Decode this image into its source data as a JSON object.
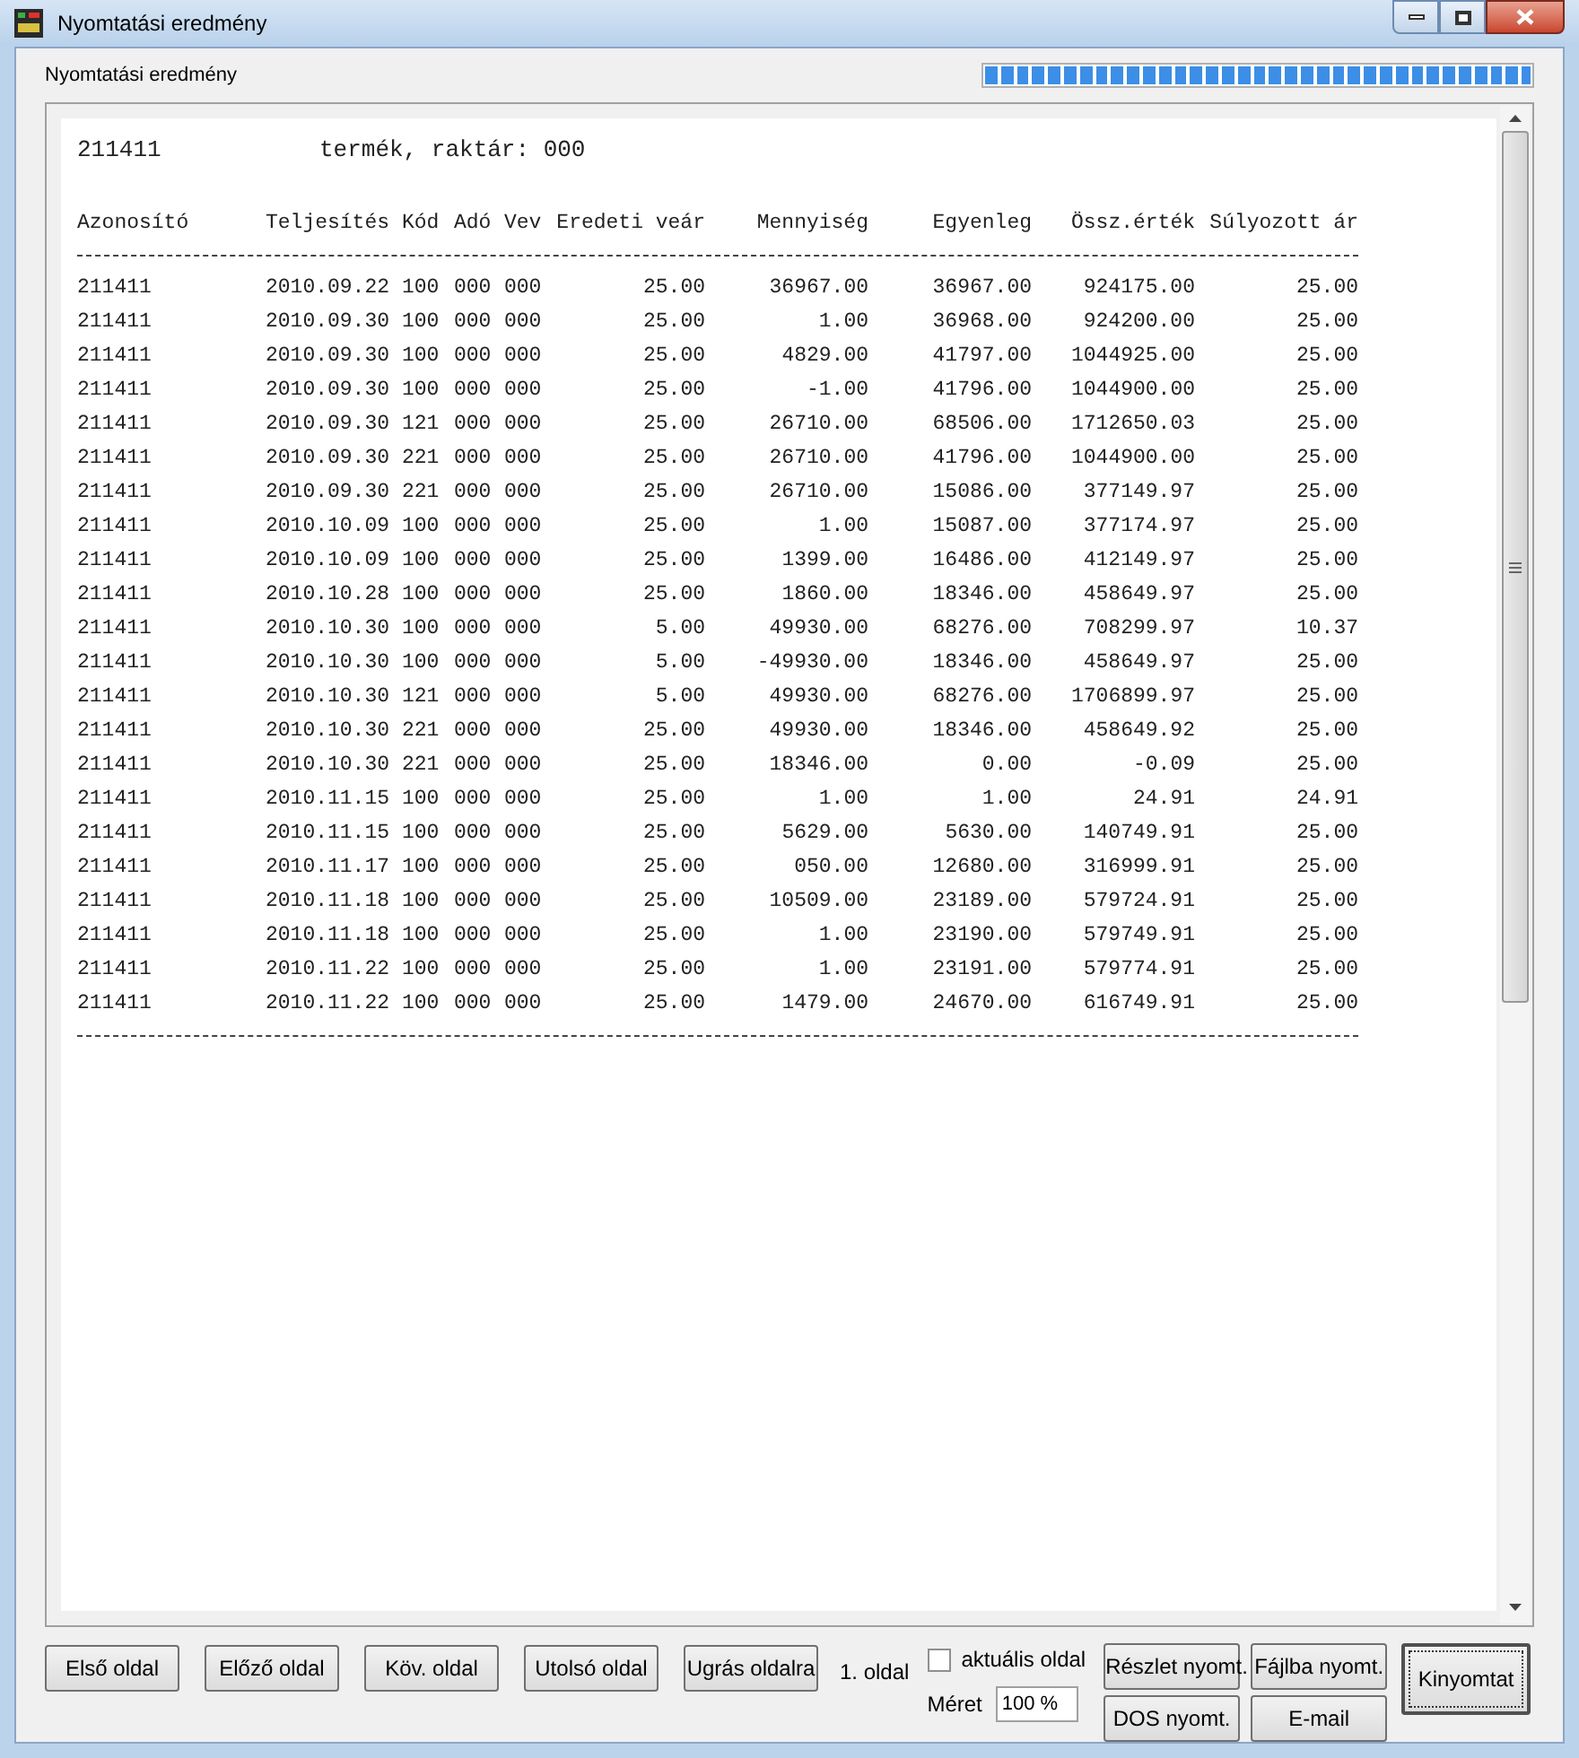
{
  "window": {
    "title": "Nyomtatási eredmény"
  },
  "header": {
    "label": "Nyomtatási eredmény",
    "progress": {
      "level": 1
    }
  },
  "report": {
    "heading": [
      "211411",
      "termék, raktár: 000"
    ],
    "columns": [
      {
        "label": "Azonosító",
        "kind": "text"
      },
      {
        "label": "Teljesítés",
        "kind": "text"
      },
      {
        "label": "Kód",
        "kind": "text"
      },
      {
        "label": "Adó",
        "kind": "text"
      },
      {
        "label": "Vev",
        "kind": "text"
      },
      {
        "label": "Eredeti veár",
        "kind": "number"
      },
      {
        "label": "Mennyiség",
        "kind": "number"
      },
      {
        "label": "Egyenleg",
        "kind": "number"
      },
      {
        "label": "Össz.érték",
        "kind": "number"
      },
      {
        "label": "Súlyozott ár",
        "kind": "number"
      }
    ],
    "rows": [
      [
        "211411",
        "2010.09.22",
        "100",
        "000",
        "000",
        "25.00",
        "36967.00",
        "36967.00",
        "924175.00",
        "25.00"
      ],
      [
        "211411",
        "2010.09.30",
        "100",
        "000",
        "000",
        "25.00",
        "1.00",
        "36968.00",
        "924200.00",
        "25.00"
      ],
      [
        "211411",
        "2010.09.30",
        "100",
        "000",
        "000",
        "25.00",
        "4829.00",
        "41797.00",
        "1044925.00",
        "25.00"
      ],
      [
        "211411",
        "2010.09.30",
        "100",
        "000",
        "000",
        "25.00",
        "-1.00",
        "41796.00",
        "1044900.00",
        "25.00"
      ],
      [
        "211411",
        "2010.09.30",
        "121",
        "000",
        "000",
        "25.00",
        "26710.00",
        "68506.00",
        "1712650.03",
        "25.00"
      ],
      [
        "211411",
        "2010.09.30",
        "221",
        "000",
        "000",
        "25.00",
        "26710.00",
        "41796.00",
        "1044900.00",
        "25.00"
      ],
      [
        "211411",
        "2010.09.30",
        "221",
        "000",
        "000",
        "25.00",
        "26710.00",
        "15086.00",
        "377149.97",
        "25.00"
      ],
      [
        "211411",
        "2010.10.09",
        "100",
        "000",
        "000",
        "25.00",
        "1.00",
        "15087.00",
        "377174.97",
        "25.00"
      ],
      [
        "211411",
        "2010.10.09",
        "100",
        "000",
        "000",
        "25.00",
        "1399.00",
        "16486.00",
        "412149.97",
        "25.00"
      ],
      [
        "211411",
        "2010.10.28",
        "100",
        "000",
        "000",
        "25.00",
        "1860.00",
        "18346.00",
        "458649.97",
        "25.00"
      ],
      [
        "211411",
        "2010.10.30",
        "100",
        "000",
        "000",
        "5.00",
        "49930.00",
        "68276.00",
        "708299.97",
        "10.37"
      ],
      [
        "211411",
        "2010.10.30",
        "100",
        "000",
        "000",
        "5.00",
        "-49930.00",
        "18346.00",
        "458649.97",
        "25.00"
      ],
      [
        "211411",
        "2010.10.30",
        "121",
        "000",
        "000",
        "5.00",
        "49930.00",
        "68276.00",
        "1706899.97",
        "25.00"
      ],
      [
        "211411",
        "2010.10.30",
        "221",
        "000",
        "000",
        "25.00",
        "49930.00",
        "18346.00",
        "458649.92",
        "25.00"
      ],
      [
        "211411",
        "2010.10.30",
        "221",
        "000",
        "000",
        "25.00",
        "18346.00",
        "0.00",
        "-0.09",
        "25.00"
      ],
      [
        "211411",
        "2010.11.15",
        "100",
        "000",
        "000",
        "25.00",
        "1.00",
        "1.00",
        "24.91",
        "24.91"
      ],
      [
        "211411",
        "2010.11.15",
        "100",
        "000",
        "000",
        "25.00",
        "5629.00",
        "5630.00",
        "140749.91",
        "25.00"
      ],
      [
        "211411",
        "2010.11.17",
        "100",
        "000",
        "000",
        "25.00",
        "050.00",
        "12680.00",
        "316999.91",
        "25.00"
      ],
      [
        "211411",
        "2010.11.18",
        "100",
        "000",
        "000",
        "25.00",
        "10509.00",
        "23189.00",
        "579724.91",
        "25.00"
      ],
      [
        "211411",
        "2010.11.18",
        "100",
        "000",
        "000",
        "25.00",
        "1.00",
        "23190.00",
        "579749.91",
        "25.00"
      ],
      [
        "211411",
        "2010.11.22",
        "100",
        "000",
        "000",
        "25.00",
        "1.00",
        "23191.00",
        "579774.91",
        "25.00"
      ],
      [
        "211411",
        "2010.11.22",
        "100",
        "000",
        "000",
        "25.00",
        "1479.00",
        "24670.00",
        "616749.91",
        "25.00"
      ]
    ]
  },
  "toolbar": {
    "nav_buttons": [
      "Első oldal",
      "Előző oldal",
      "Köv. oldal",
      "Utolsó oldal",
      "Ugrás oldalra"
    ],
    "page_label": "1. oldal",
    "current_page": {
      "label": "aktuális oldal",
      "checked": false
    },
    "size": {
      "label": "Méret",
      "value": "100 %"
    },
    "print_buttons": [
      "Részlet nyomt.",
      "Fájlba nyomt.",
      "DOS nyomt.",
      "E-mail"
    ],
    "main_button": "Kinyomtat"
  }
}
